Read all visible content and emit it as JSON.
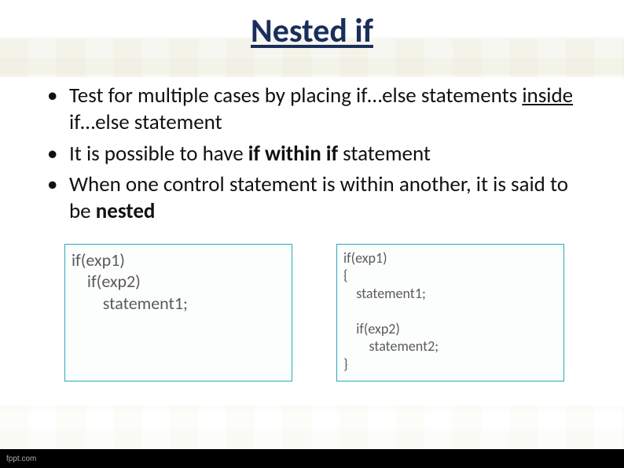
{
  "title": "Nested if",
  "bullets": {
    "b1a": "Test for multiple cases by placing if…else statements ",
    "b1b": "inside",
    "b1c": " if…else statement",
    "b2a": "It is possible to have ",
    "b2b": "if within if",
    "b2c": " statement",
    "b3a": "When one control statement is within another, it is said to be ",
    "b3b": "nested"
  },
  "code": {
    "left": "if(exp1)\n    if(exp2)\n        statement1;",
    "right": "if(exp1)\n{\n    statement1;\n\n    if(exp2)\n        statement2;\n}"
  },
  "footer": "fppt.com"
}
